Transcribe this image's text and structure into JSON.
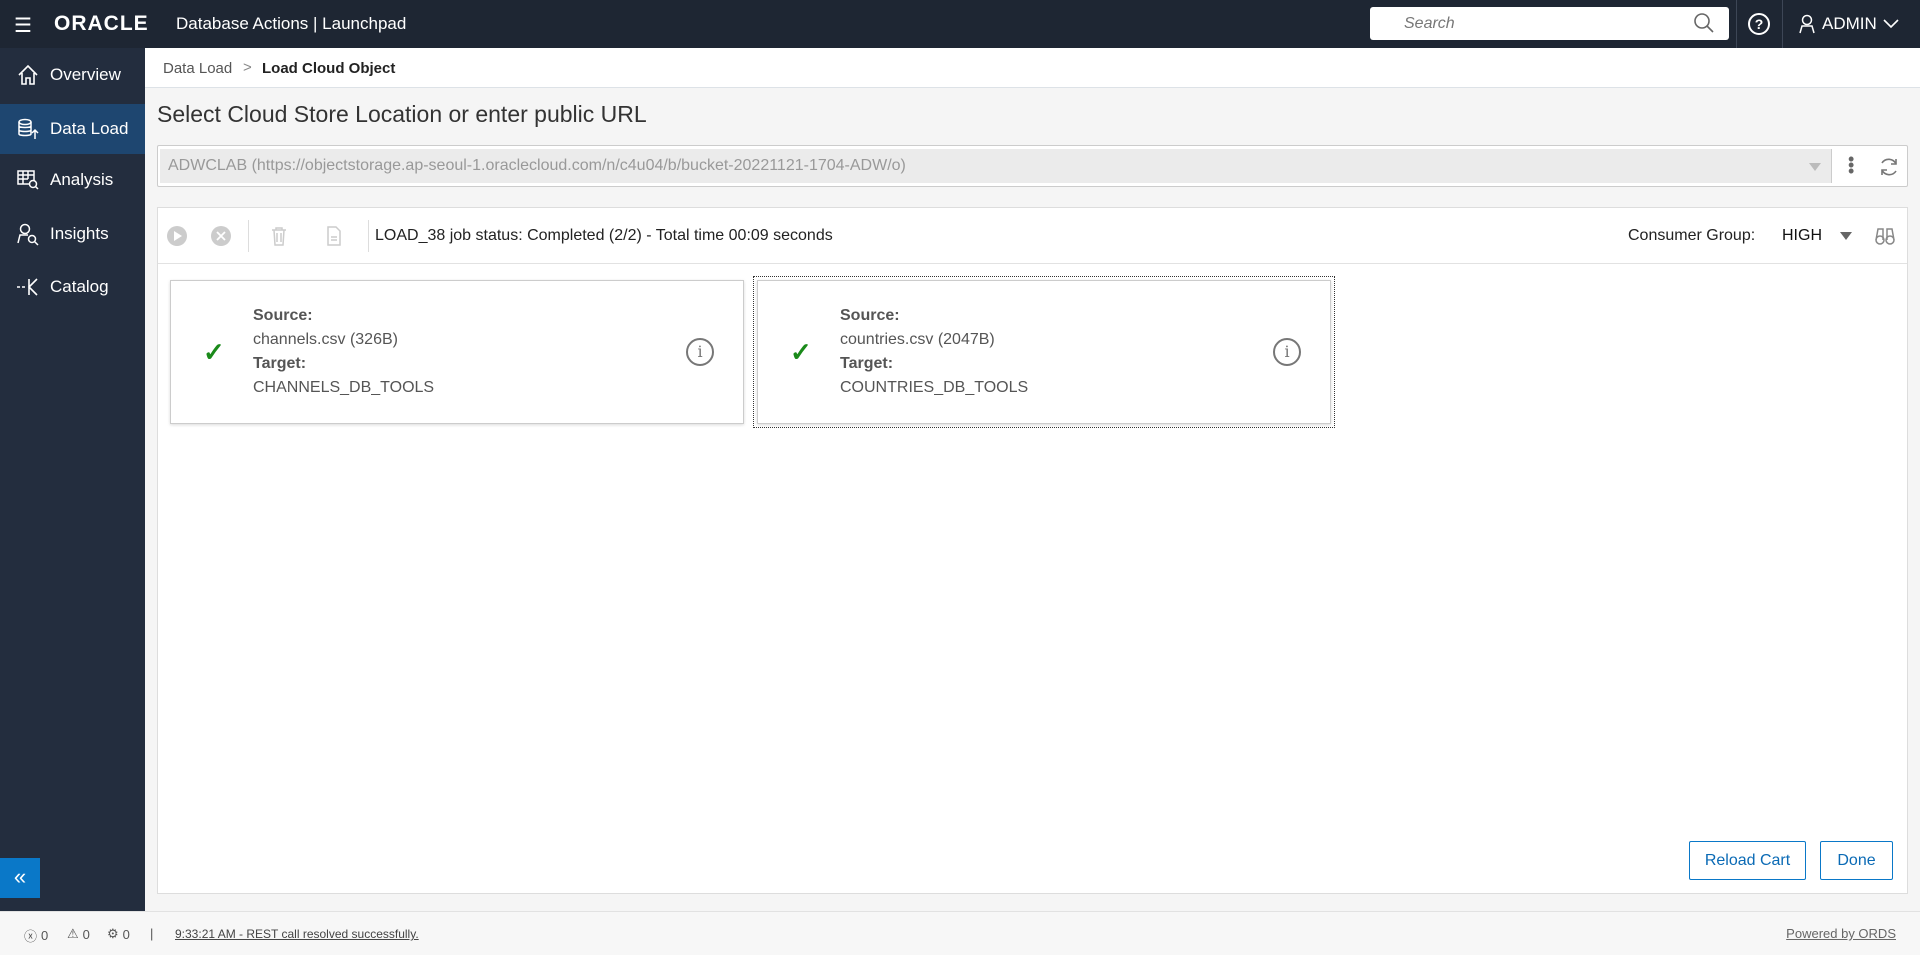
{
  "header": {
    "logo": "ORACLE",
    "app_title": "Database Actions |  Launchpad",
    "search_placeholder": "Search",
    "user": "ADMIN"
  },
  "sidebar": {
    "items": [
      {
        "label": "Overview",
        "icon": "home-icon",
        "active": false
      },
      {
        "label": "Data Load",
        "icon": "database-upload-icon",
        "active": true
      },
      {
        "label": "Analysis",
        "icon": "table-search-icon",
        "active": false
      },
      {
        "label": "Insights",
        "icon": "person-search-icon",
        "active": false
      },
      {
        "label": "Catalog",
        "icon": "catalog-icon",
        "active": false
      }
    ],
    "collapse_label": "«"
  },
  "breadcrumb": {
    "parent": "Data Load",
    "separator": ">",
    "current": "Load Cloud Object"
  },
  "page_title": "Select Cloud Store Location or enter public URL",
  "location": {
    "value": "ADWCLAB (https://objectstorage.ap-seoul-1.oraclecloud.com/n/c4u04/b/bucket-20221121-1704-ADW/o)"
  },
  "toolbar": {
    "job_status": "LOAD_38 job status: Completed (2/2) - Total time 00:09 seconds",
    "consumer_group_label": "Consumer Group:",
    "consumer_group_value": "HIGH"
  },
  "cards": [
    {
      "source_label": "Source:",
      "source": "channels.csv (326B)",
      "target_label": "Target:",
      "target": "CHANNELS_DB_TOOLS",
      "status": "completed"
    },
    {
      "source_label": "Source:",
      "source": "countries.csv (2047B)",
      "target_label": "Target:",
      "target": "COUNTRIES_DB_TOOLS",
      "status": "completed"
    }
  ],
  "actions": {
    "reload": "Reload Cart",
    "done": "Done"
  },
  "statusbar": {
    "errors": "0",
    "warnings": "0",
    "tasks": "0",
    "sep": "|",
    "message": "9:33:21 AM - REST call resolved successfully.",
    "powered": "Powered by ORDS"
  },
  "colors": {
    "topbar": "#1e2633",
    "sidebar": "#232d3e",
    "active": "#1e4670",
    "accent": "#0a78c8",
    "success": "#1a8a1a"
  }
}
